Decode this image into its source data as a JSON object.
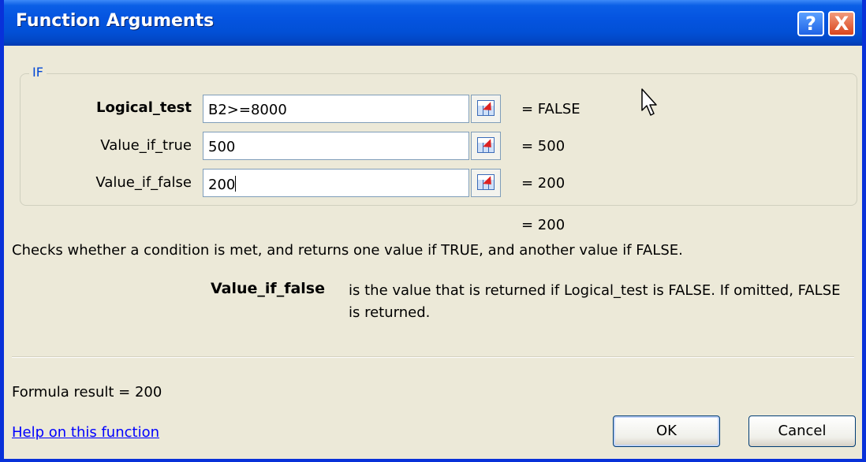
{
  "dialog": {
    "title": "Function Arguments",
    "help_button": "?",
    "close_button": "X"
  },
  "group": {
    "label": "IF",
    "args": [
      {
        "label": "Logical_test",
        "value": "B2>=8000",
        "result": "=  FALSE",
        "bold": true
      },
      {
        "label": "Value_if_true",
        "value": "500",
        "result": "=  500",
        "bold": false
      },
      {
        "label": "Value_if_false",
        "value": "200",
        "result": "=  200",
        "bold": false
      }
    ]
  },
  "function_result": "=  200",
  "description": "Checks whether a condition is met, and returns one value if TRUE, and another value if FALSE.",
  "selected_param": {
    "name": "Value_if_false",
    "description": "is the value that is returned if Logical_test is FALSE. If omitted, FALSE is returned."
  },
  "formula_result": "Formula result =   200",
  "help_link": "Help on this function",
  "buttons": {
    "ok": "OK",
    "cancel": "Cancel"
  },
  "icons": {
    "collapse": "collapse-dialog-icon",
    "cursor": "mouse-pointer-icon"
  }
}
